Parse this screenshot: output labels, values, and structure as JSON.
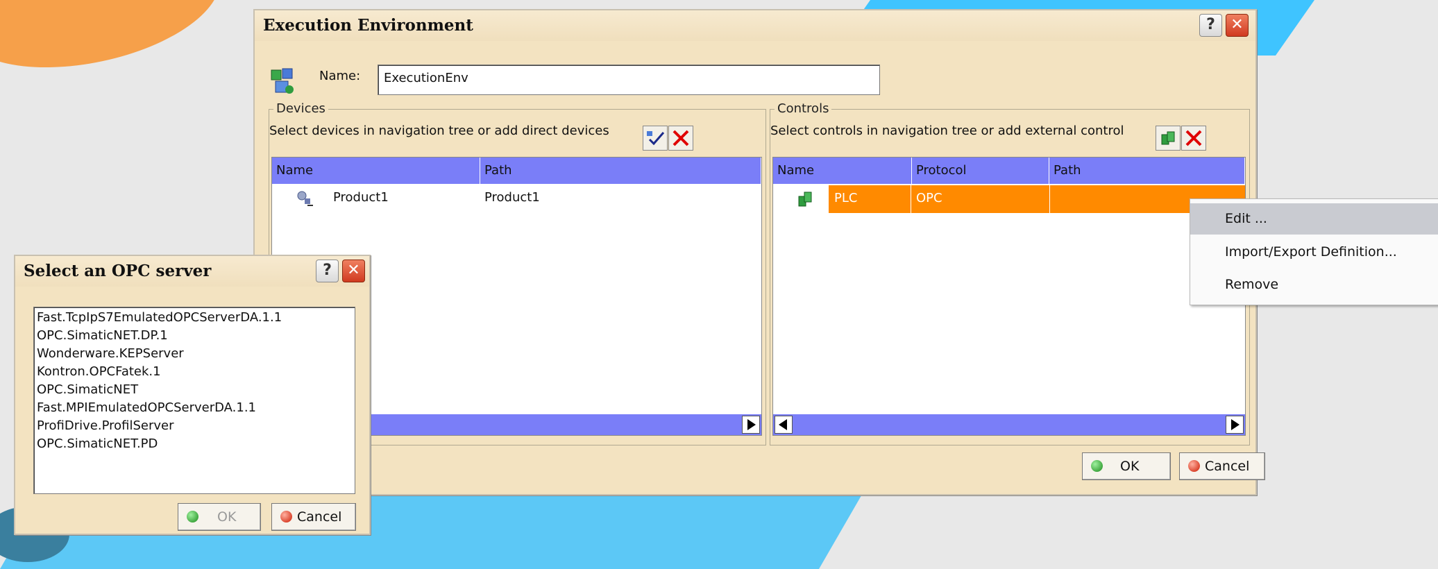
{
  "main_dialog": {
    "title": "Execution Environment",
    "name_label": "Name:",
    "name_value": "ExecutionEnv",
    "help_icon": "?",
    "close_icon": "✕",
    "devices": {
      "group_label": "Devices",
      "hint": "Select devices in navigation tree or add direct devices",
      "columns": [
        "Name",
        "Path"
      ],
      "rows": [
        {
          "name": "Product1",
          "path": "Product1"
        }
      ]
    },
    "controls": {
      "group_label": "Controls",
      "hint": "Select controls in navigation tree or add external control",
      "columns": [
        "Name",
        "Protocol",
        "Path"
      ],
      "rows": [
        {
          "name": "PLC",
          "protocol": "OPC",
          "path": ""
        }
      ]
    },
    "ok_label": "OK",
    "cancel_label": "Cancel"
  },
  "context_menu": {
    "items": [
      "Edit ...",
      "Import/Export Definition...",
      "Remove"
    ]
  },
  "opc_dialog": {
    "title": "Select an OPC server",
    "help_icon": "?",
    "close_icon": "✕",
    "servers": [
      "Fast.TcpIpS7EmulatedOPCServerDA.1.1",
      "OPC.SimaticNET.DP.1",
      "Wonderware.KEPServer",
      "Kontron.OPCFatek.1",
      "OPC.SimaticNET",
      "Fast.MPIEmulatedOPCServerDA.1.1",
      "ProfiDrive.ProfilServer",
      "OPC.SimaticNET.PD"
    ],
    "ok_label": "OK",
    "cancel_label": "Cancel"
  },
  "colors": {
    "dialog_bg": "#f3e3c1",
    "header_blue": "#7a7ef8",
    "selection_orange": "#ff8a00",
    "menu_highlight": "#c9cbd1"
  }
}
